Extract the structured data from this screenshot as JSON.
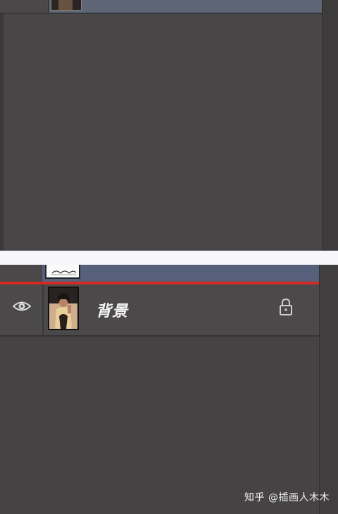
{
  "layers_panel_bottom": {
    "background_layer": {
      "name": "背景",
      "visibility_icon": "eye-icon",
      "lock_icon": "lock-icon",
      "visible": true,
      "locked": true
    },
    "selected_layer": {
      "highlight_color": "#d42a24",
      "selection_color": "#56607a"
    }
  },
  "watermark": {
    "text": "知乎 @插画人木木"
  },
  "colors": {
    "panel_bg": "#454343",
    "selection_blue": "#5d6577",
    "highlight_red": "#d42a24",
    "gap_white": "#f6f6fb"
  }
}
